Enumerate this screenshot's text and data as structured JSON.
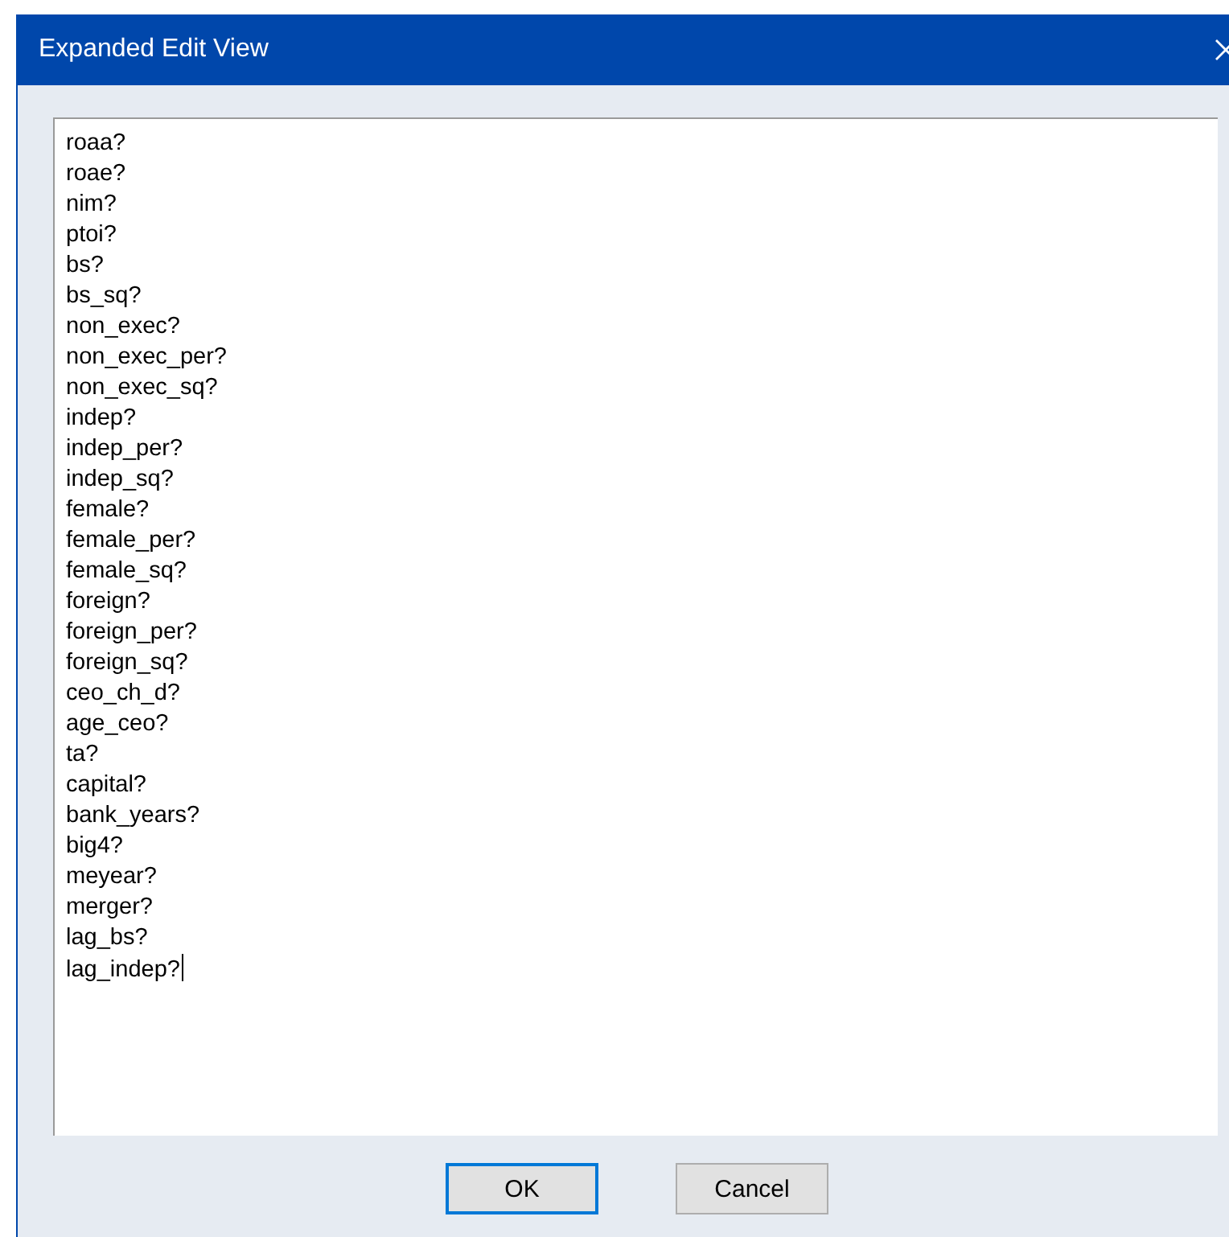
{
  "window": {
    "title": "Expanded Edit View"
  },
  "editor": {
    "lines": [
      "roaa?",
      "roae?",
      "nim?",
      "ptoi?",
      "bs?",
      "bs_sq?",
      "non_exec?",
      "non_exec_per?",
      "non_exec_sq?",
      "indep?",
      "indep_per?",
      "indep_sq?",
      "female?",
      "female_per?",
      "female_sq?",
      "foreign?",
      "foreign_per?",
      "foreign_sq?",
      "ceo_ch_d?",
      "age_ceo?",
      "ta?",
      "capital?",
      "bank_years?",
      "big4?",
      "meyear?",
      "merger?",
      "lag_bs?",
      "lag_indep?"
    ],
    "caret": true
  },
  "buttons": [
    {
      "label": "OK",
      "default": true
    },
    {
      "label": "Cancel",
      "default": false
    }
  ]
}
